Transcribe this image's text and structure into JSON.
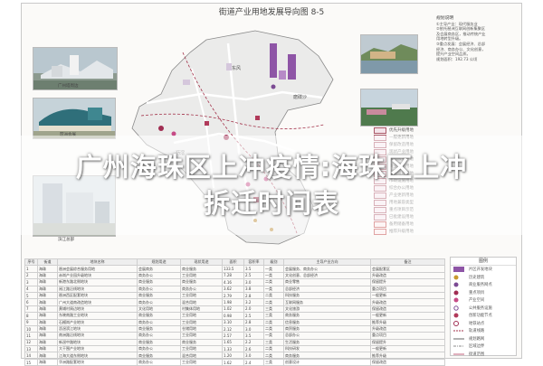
{
  "doc": {
    "title": "街道产业用地发展导向图 8-5",
    "district_labels": [
      "东风",
      "沥滘",
      "磨碟沙"
    ]
  },
  "photos": {
    "left_top_caption": "广州塔周边",
    "left_mid_caption": "琶洲会展",
    "left_low_caption": "滨江总部"
  },
  "notes": {
    "heading": "规划说明",
    "lines": [
      "①主导产业：现代服务业",
      "②依托琶洲互联网创新集聚区",
      "及会展商务区，推动传统产业",
      "用地转型升级。",
      "③重点发展：会展经济、总部",
      "经济、商务办公、文化创意，",
      "提升产业空间品质。",
      "规划面积：192.73 公顷"
    ]
  },
  "mid_legend": [
    {
      "label": "优先升级用地"
    },
    {
      "label": "一般更新用地"
    },
    {
      "label": "保留改造用地"
    },
    {
      "label": "现状产业用地"
    },
    {
      "label": "规划服务用地"
    },
    {
      "label": "商业服务用地"
    },
    {
      "label": "公共设施用地"
    },
    {
      "label": "市政设施用地"
    },
    {
      "label": "综合办公用地"
    },
    {
      "label": "产业更新用地"
    },
    {
      "label": "用地兼容类型"
    },
    {
      "label": "重点项目示范"
    },
    {
      "label": "已批建设用地"
    },
    {
      "label": "备用储备用地"
    },
    {
      "label": "推荐升级用地"
    }
  ],
  "table": {
    "headers": [
      "序号",
      "街道",
      "地块名称",
      "规划用途",
      "现状用途",
      "面积",
      "容积率",
      "级别",
      "主导产业方向",
      "备注"
    ],
    "rows": [
      [
        "1",
        "海珠",
        "琶洲会展综合服务用地",
        "会展商务",
        "商业服务",
        "133.5",
        "3.5",
        "一类",
        "会展服务、商务办公",
        "会展配套区"
      ],
      [
        "2",
        "海珠",
        "赤岗产业园升级地块",
        "商务办公",
        "工业用地",
        "7.28",
        "2.5",
        "一类",
        "文化创意、总部经济",
        "升级改造"
      ],
      [
        "3",
        "海珠",
        "新港东路北侧地块",
        "商业服务",
        "商业服务",
        "4.16",
        "3.0",
        "二类",
        "商业零售",
        "保留提升"
      ],
      [
        "4",
        "海珠",
        "阅江路沿线地块",
        "商务办公",
        "商务办公",
        "3.62",
        "3.8",
        "一类",
        "总部经济",
        "重点项目"
      ],
      [
        "5",
        "海珠",
        "琶洲西区配套地块",
        "商业服务",
        "工业用地",
        "2.79",
        "2.8",
        "二类",
        "科技服务",
        "一般更新"
      ],
      [
        "6",
        "海珠",
        "广州大道南改造地块",
        "商务办公",
        "混合用地",
        "1.98",
        "3.2",
        "二类",
        "互联网服务",
        "升级改造"
      ],
      [
        "7",
        "海珠",
        "黄埔村周边地块",
        "文化用地",
        "村集体用地",
        "1.02",
        "2.0",
        "三类",
        "文化旅游",
        "保留改造"
      ],
      [
        "8",
        "海珠",
        "东晓南路工业地块",
        "商业服务",
        "工业用地",
        "0.98",
        "2.5",
        "三类",
        "商务服务",
        "一般更新"
      ],
      [
        "9",
        "海珠",
        "石榴岗产业地块",
        "商务办公",
        "工业用地",
        "3.10",
        "2.8",
        "二类",
        "信息服务",
        "推荐升级"
      ],
      [
        "10",
        "海珠",
        "沥滘滨江地块",
        "商业服务",
        "仓储用地",
        "2.12",
        "3.0",
        "二类",
        "商贸服务",
        "升级改造"
      ],
      [
        "11",
        "海珠",
        "南洲路沿线地块",
        "商务办公",
        "工业用地",
        "2.57",
        "3.5",
        "一类",
        "总部办公",
        "重点项目"
      ],
      [
        "12",
        "海珠",
        "新滘中路地块",
        "商业服务",
        "商业服务",
        "1.65",
        "2.2",
        "三类",
        "生活服务",
        "保留提升"
      ],
      [
        "13",
        "海珠",
        "大干围产业地块",
        "商务办公",
        "工业用地",
        "1.33",
        "2.6",
        "二类",
        "科技研发",
        "一般更新"
      ],
      [
        "14",
        "海珠",
        "江海大道东侧地块",
        "商业服务",
        "混合用地",
        "1.20",
        "3.0",
        "二类",
        "商务服务",
        "推荐升级"
      ],
      [
        "15",
        "海珠",
        "华洲路配套地块",
        "商务办公",
        "工业用地",
        "1.62",
        "2.4",
        "三类",
        "创意设计",
        "保留改造"
      ]
    ]
  },
  "legend": {
    "title": "图例",
    "items": [
      {
        "label": "片区开发地块"
      },
      {
        "label": "历史建筑"
      },
      {
        "label": "商业服务网点"
      },
      {
        "label": "重点项目"
      },
      {
        "label": "产业空间"
      },
      {
        "label": "公共服务设施"
      },
      {
        "label": "创新功能节点"
      },
      {
        "label": "地铁站点"
      },
      {
        "label": "轨道线路"
      },
      {
        "label": "规划路网"
      },
      {
        "label": "区域边界"
      },
      {
        "label": "街道范围"
      }
    ]
  },
  "overlay": {
    "line1": "广州海珠区上冲疫情:海珠区上冲",
    "line2": "拆迁时间表"
  }
}
